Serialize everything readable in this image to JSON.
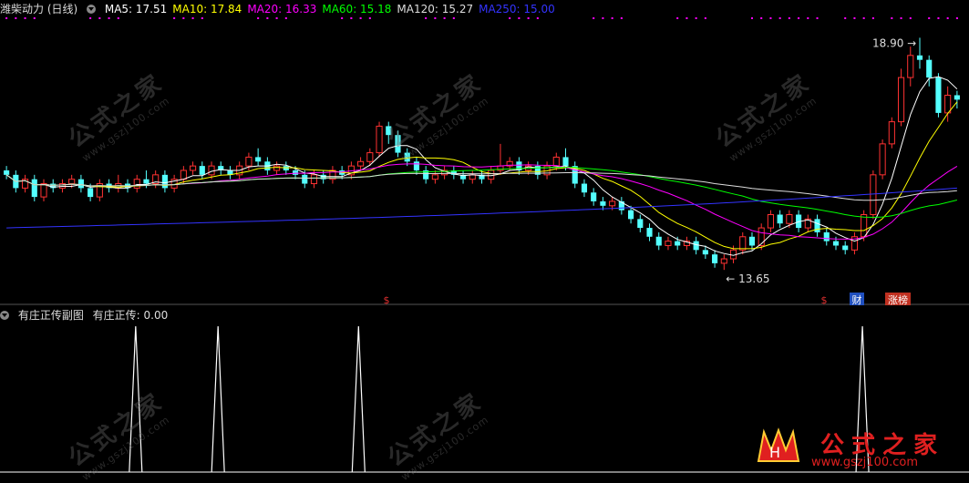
{
  "upper_panel": {
    "title": "潍柴动力 (日线)",
    "ma_labels": [
      {
        "text": "MA5: 17.51",
        "color": "#ffffff"
      },
      {
        "text": "MA10: 17.84",
        "color": "#ffff00"
      },
      {
        "text": "MA20: 16.33",
        "color": "#ff00ff"
      },
      {
        "text": "MA60: 15.18",
        "color": "#00ff00"
      },
      {
        "text": "MA120: 15.27",
        "color": "#dddddd"
      },
      {
        "text": "MA250: 15.00",
        "color": "#3333ff"
      }
    ],
    "high_label": "18.90",
    "low_label": "13.65",
    "markers": [
      {
        "text": "$",
        "color": "#e03030"
      },
      {
        "text": "$",
        "color": "#e03030"
      },
      {
        "text": "财",
        "color": "#ffffff",
        "bg": "#2050c0"
      },
      {
        "text": "涨榜",
        "color": "#ffffff",
        "bg": "#c03020"
      }
    ]
  },
  "lower_panel": {
    "title": "有庄正传副图",
    "value_label": "有庄正传: 0.00"
  },
  "watermark": {
    "text": "公式之家",
    "url": "www.gszj100.com"
  },
  "logo": {
    "text": "公式之家",
    "url": "www.gszj100.com"
  },
  "colors": {
    "up": "#ff3232",
    "down": "#54ffff",
    "bg": "#000000",
    "ma5": "#ffffff",
    "ma10": "#ffff00",
    "ma20": "#ff00ff",
    "ma60": "#00ff00",
    "ma120": "#dddddd",
    "ma250": "#3333ff",
    "dot": "#ff00ff"
  },
  "chart_data": {
    "type": "candlestick",
    "ylim": [
      13.2,
      19.3
    ],
    "candles": [
      [
        15.9,
        15.8,
        16.0,
        15.7
      ],
      [
        15.8,
        15.5,
        15.9,
        15.4
      ],
      [
        15.5,
        15.7,
        15.8,
        15.4
      ],
      [
        15.7,
        15.3,
        15.8,
        15.2
      ],
      [
        15.3,
        15.6,
        15.7,
        15.2
      ],
      [
        15.6,
        15.5,
        15.7,
        15.4
      ],
      [
        15.5,
        15.6,
        15.7,
        15.4
      ],
      [
        15.6,
        15.7,
        15.8,
        15.5
      ],
      [
        15.7,
        15.5,
        15.8,
        15.4
      ],
      [
        15.5,
        15.3,
        15.6,
        15.2
      ],
      [
        15.3,
        15.6,
        15.7,
        15.2
      ],
      [
        15.6,
        15.5,
        15.7,
        15.4
      ],
      [
        15.5,
        15.6,
        15.8,
        15.4
      ],
      [
        15.6,
        15.5,
        15.7,
        15.4
      ],
      [
        15.5,
        15.7,
        15.8,
        15.4
      ],
      [
        15.7,
        15.6,
        15.9,
        15.5
      ],
      [
        15.6,
        15.8,
        15.9,
        15.5
      ],
      [
        15.8,
        15.5,
        15.9,
        15.4
      ],
      [
        15.5,
        15.7,
        15.8,
        15.4
      ],
      [
        15.7,
        15.9,
        16.0,
        15.6
      ],
      [
        15.9,
        16.0,
        16.1,
        15.8
      ],
      [
        16.0,
        15.8,
        16.1,
        15.7
      ],
      [
        15.8,
        16.0,
        16.1,
        15.7
      ],
      [
        16.0,
        15.9,
        16.1,
        15.8
      ],
      [
        15.9,
        15.8,
        16.0,
        15.7
      ],
      [
        15.8,
        16.0,
        16.1,
        15.7
      ],
      [
        16.0,
        16.2,
        16.3,
        15.9
      ],
      [
        16.2,
        16.1,
        16.4,
        16.0
      ],
      [
        16.1,
        15.9,
        16.2,
        15.8
      ],
      [
        15.9,
        16.0,
        16.1,
        15.8
      ],
      [
        16.0,
        15.9,
        16.1,
        15.8
      ],
      [
        15.9,
        15.8,
        16.0,
        15.7
      ],
      [
        15.8,
        15.6,
        15.9,
        15.5
      ],
      [
        15.6,
        15.8,
        15.9,
        15.5
      ],
      [
        15.8,
        15.7,
        15.9,
        15.6
      ],
      [
        15.7,
        15.9,
        16.0,
        15.6
      ],
      [
        15.9,
        15.8,
        16.0,
        15.7
      ],
      [
        15.8,
        16.0,
        16.1,
        15.7
      ],
      [
        16.0,
        16.1,
        16.2,
        15.9
      ],
      [
        16.1,
        16.3,
        16.4,
        16.0
      ],
      [
        16.3,
        16.9,
        17.0,
        16.2
      ],
      [
        16.9,
        16.7,
        17.0,
        16.5
      ],
      [
        16.7,
        16.3,
        16.8,
        16.2
      ],
      [
        16.3,
        16.1,
        16.4,
        16.0
      ],
      [
        16.1,
        15.9,
        16.2,
        15.8
      ],
      [
        15.9,
        15.7,
        16.0,
        15.6
      ],
      [
        15.7,
        15.8,
        15.9,
        15.6
      ],
      [
        15.8,
        15.9,
        16.0,
        15.7
      ],
      [
        15.9,
        15.8,
        16.0,
        15.7
      ],
      [
        15.8,
        15.7,
        15.9,
        15.6
      ],
      [
        15.7,
        15.8,
        15.9,
        15.6
      ],
      [
        15.8,
        15.7,
        15.9,
        15.6
      ],
      [
        15.7,
        15.9,
        16.0,
        15.6
      ],
      [
        15.9,
        16.0,
        16.5,
        15.8
      ],
      [
        16.0,
        16.1,
        16.2,
        15.9
      ],
      [
        16.1,
        15.9,
        16.2,
        15.8
      ],
      [
        15.9,
        16.0,
        16.1,
        15.8
      ],
      [
        16.0,
        15.8,
        16.1,
        15.7
      ],
      [
        15.8,
        16.0,
        16.1,
        15.7
      ],
      [
        16.0,
        16.2,
        16.3,
        15.9
      ],
      [
        16.2,
        16.0,
        16.4,
        15.9
      ],
      [
        16.0,
        15.6,
        16.1,
        15.5
      ],
      [
        15.6,
        15.4,
        15.7,
        15.3
      ],
      [
        15.4,
        15.2,
        15.5,
        15.1
      ],
      [
        15.2,
        15.1,
        15.3,
        15.0
      ],
      [
        15.1,
        15.2,
        15.3,
        15.0
      ],
      [
        15.2,
        15.0,
        15.3,
        14.9
      ],
      [
        15.0,
        14.8,
        15.1,
        14.7
      ],
      [
        14.8,
        14.6,
        14.9,
        14.5
      ],
      [
        14.6,
        14.4,
        14.7,
        14.3
      ],
      [
        14.4,
        14.2,
        14.5,
        14.1
      ],
      [
        14.2,
        14.3,
        14.4,
        14.1
      ],
      [
        14.3,
        14.2,
        14.4,
        14.1
      ],
      [
        14.2,
        14.3,
        14.4,
        14.1
      ],
      [
        14.3,
        14.1,
        14.4,
        14.0
      ],
      [
        14.1,
        14.0,
        14.2,
        13.9
      ],
      [
        14.0,
        13.8,
        14.1,
        13.7
      ],
      [
        13.8,
        13.9,
        14.0,
        13.65
      ],
      [
        13.9,
        14.1,
        14.2,
        13.8
      ],
      [
        14.1,
        14.4,
        14.5,
        14.0
      ],
      [
        14.4,
        14.2,
        14.5,
        14.1
      ],
      [
        14.2,
        14.6,
        14.7,
        14.1
      ],
      [
        14.6,
        14.9,
        15.0,
        14.5
      ],
      [
        14.9,
        14.7,
        15.0,
        14.6
      ],
      [
        14.7,
        14.9,
        15.0,
        14.6
      ],
      [
        14.9,
        14.6,
        15.0,
        14.5
      ],
      [
        14.6,
        14.8,
        14.9,
        14.5
      ],
      [
        14.8,
        14.5,
        14.9,
        14.4
      ],
      [
        14.5,
        14.3,
        14.6,
        14.2
      ],
      [
        14.3,
        14.2,
        14.4,
        14.1
      ],
      [
        14.2,
        14.1,
        14.3,
        14.0
      ],
      [
        14.1,
        14.4,
        14.5,
        14.0
      ],
      [
        14.4,
        14.9,
        15.0,
        14.3
      ],
      [
        14.9,
        15.8,
        15.9,
        14.8
      ],
      [
        15.8,
        16.5,
        16.6,
        15.7
      ],
      [
        16.5,
        17.0,
        17.1,
        16.4
      ],
      [
        17.0,
        18.0,
        18.2,
        16.9
      ],
      [
        18.0,
        18.5,
        18.7,
        17.8
      ],
      [
        18.5,
        18.4,
        18.9,
        18.2
      ],
      [
        18.4,
        18.0,
        18.5,
        17.8
      ],
      [
        18.0,
        17.2,
        18.1,
        17.1
      ],
      [
        17.2,
        17.6,
        17.8,
        17.0
      ],
      [
        17.6,
        17.5,
        17.7,
        17.3
      ]
    ],
    "indicator": {
      "name": "有庄正传",
      "spike_positions": [
        0.14,
        0.225,
        0.37,
        0.89
      ],
      "ylim": [
        0,
        1
      ]
    }
  }
}
